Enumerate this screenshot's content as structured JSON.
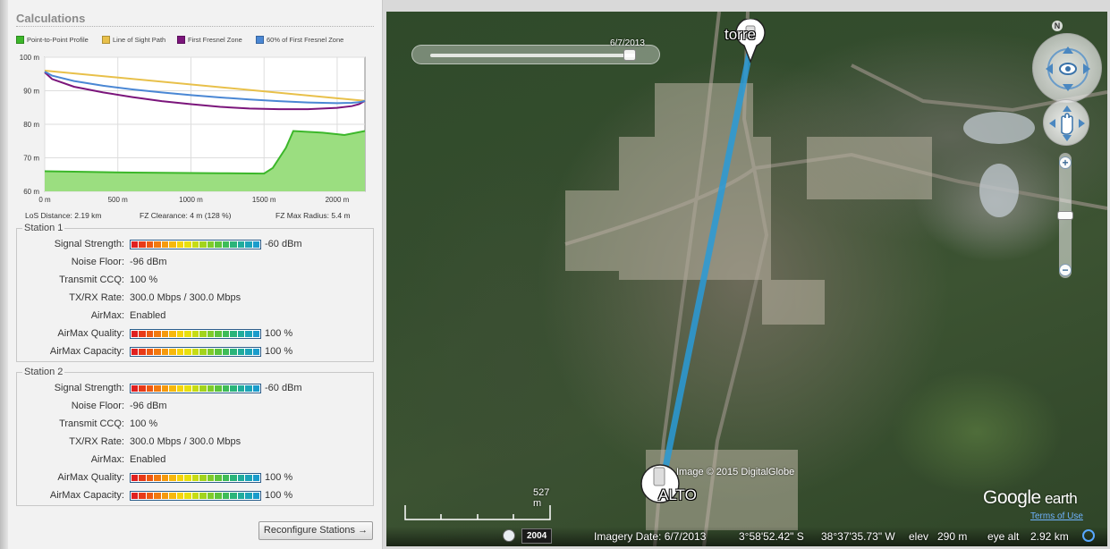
{
  "calc": {
    "title": "Calculations",
    "legend": [
      {
        "label": "Point-to-Point Profile",
        "color": "#3cb72a"
      },
      {
        "label": "Line of Sight Path",
        "color": "#e8c04a"
      },
      {
        "label": "First Fresnel Zone",
        "color": "#7b157b"
      },
      {
        "label": "60% of First Fresnel Zone",
        "color": "#4a87d4"
      }
    ],
    "stats": {
      "los": "LoS Distance: 2.19 km",
      "fz": "FZ Clearance: 4 m  (128 %)",
      "fzmax": "FZ Max Radius: 5.4 m"
    }
  },
  "chart_data": {
    "type": "area",
    "x_ticks": [
      "0 m",
      "500 m",
      "1000 m",
      "1500 m",
      "2000 m"
    ],
    "y_ticks": [
      "60 m",
      "70 m",
      "80 m",
      "90 m",
      "100 m"
    ],
    "xlim": [
      0,
      2190
    ],
    "ylim": [
      60,
      100
    ],
    "series": [
      {
        "name": "Point-to-Point Profile",
        "color": "#3cb72a",
        "x": [
          0,
          300,
          600,
          900,
          1200,
          1500,
          1560,
          1650,
          1700,
          1900,
          2050,
          2190
        ],
        "y": [
          66,
          65.8,
          65.6,
          65.5,
          65.4,
          65.3,
          67,
          73,
          78,
          77.5,
          76.8,
          78
        ]
      },
      {
        "name": "Line of Sight Path",
        "color": "#e8c04a",
        "x": [
          0,
          2190
        ],
        "y": [
          96,
          87
        ]
      },
      {
        "name": "First Fresnel Zone",
        "color": "#7b157b",
        "x": [
          0,
          50,
          200,
          400,
          600,
          800,
          1000,
          1200,
          1400,
          1600,
          1800,
          2000,
          2100,
          2150,
          2190
        ],
        "y": [
          95.5,
          93.5,
          91.2,
          89.5,
          88.1,
          86.9,
          86,
          85.2,
          84.7,
          84.5,
          84.5,
          84.9,
          85.4,
          86,
          87
        ]
      },
      {
        "name": "60% of First Fresnel Zone",
        "color": "#4a87d4",
        "x": [
          0,
          50,
          200,
          400,
          600,
          800,
          1000,
          1200,
          1400,
          1600,
          1800,
          2000,
          2100,
          2150,
          2190
        ],
        "y": [
          95.7,
          94.5,
          92.9,
          91.5,
          90.4,
          89.5,
          88.7,
          88,
          87.4,
          86.9,
          86.5,
          86.3,
          86.4,
          86.6,
          87
        ]
      }
    ]
  },
  "station1": {
    "title": "Station 1",
    "signal_label": "Signal Strength:",
    "signal_value": "-60 dBm",
    "signal_level": 1.0,
    "noise_label": "Noise Floor:",
    "noise_value": "-96 dBm",
    "ccq_label": "Transmit CCQ:",
    "ccq_value": "100 %",
    "rate_label": "TX/RX Rate:",
    "rate_value": "300.0 Mbps / 300.0 Mbps",
    "airmax_label": "AirMax:",
    "airmax_value": "Enabled",
    "quality_label": "AirMax Quality:",
    "quality_value": "100 %",
    "quality_level": 1.0,
    "capacity_label": "AirMax Capacity:",
    "capacity_value": "100 %",
    "capacity_level": 1.0
  },
  "station2": {
    "title": "Station 2",
    "signal_label": "Signal Strength:",
    "signal_value": "-60 dBm",
    "signal_level": 1.0,
    "noise_label": "Noise Floor:",
    "noise_value": "-96 dBm",
    "ccq_label": "Transmit CCQ:",
    "ccq_value": "100 %",
    "rate_label": "TX/RX Rate:",
    "rate_value": "300.0 Mbps / 300.0 Mbps",
    "airmax_label": "AirMax:",
    "airmax_value": "Enabled",
    "quality_label": "AirMax Quality:",
    "quality_value": "100 %",
    "quality_level": 1.0,
    "capacity_label": "AirMax Capacity:",
    "capacity_value": "100 %",
    "capacity_level": 1.0
  },
  "meter_colors": [
    "#e02020",
    "#e83a18",
    "#ee5a12",
    "#f27a10",
    "#f59a0e",
    "#f7b80c",
    "#f6d40c",
    "#e8e00e",
    "#c6dc14",
    "#a2d41c",
    "#7ecc2a",
    "#5cc43c",
    "#3ebc58",
    "#2ab47a",
    "#20ac9c",
    "#1ca4b8",
    "#1a9ccc"
  ],
  "reconfigure_label": "Reconfigure Stations →",
  "map": {
    "time_date": "6/7/2013",
    "north": "N",
    "pin_top": "torre",
    "pin_bottom": "ALTO",
    "link_color": "#2a9bd8",
    "copyright": "Image © 2015 DigitalGlobe",
    "logo_google": "Google",
    "logo_earth": " earth",
    "terms": "Terms of Use",
    "scale": "527 m",
    "zoom_in": "+",
    "zoom_out": "−",
    "year": "2004",
    "imagery_date": "Imagery Date: 6/7/2013",
    "lat": "3°58'52.42\" S",
    "lon": "38°37'35.73\" W",
    "elev_label": "elev",
    "elev_value": "290 m",
    "eyealt_label": "eye alt",
    "eyealt_value": "2.92 km"
  }
}
